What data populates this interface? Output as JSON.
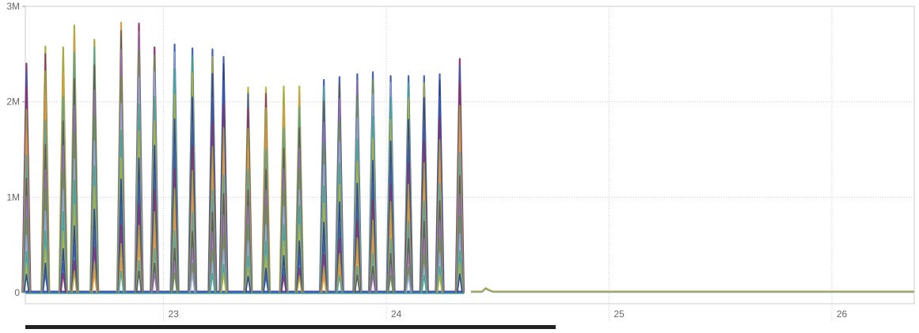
{
  "chart_data": {
    "type": "line",
    "title": "",
    "xlabel": "",
    "ylabel": "",
    "x_ticks": [
      "23",
      "24",
      "25",
      "26"
    ],
    "x_tick_values": [
      23,
      24,
      25,
      26
    ],
    "y_ticks": [
      "0",
      "1M",
      "2M",
      "3M"
    ],
    "y_tick_values": [
      0,
      1000000,
      2000000,
      3000000
    ],
    "xlim": [
      22.38,
      26.37
    ],
    "ylim": [
      0,
      3000000
    ],
    "grid": true,
    "legend": "none",
    "overlay_colors": [
      "#2b3f8f",
      "#3d5bb0",
      "#8b2f6f",
      "#a6a83a",
      "#d39b45",
      "#4fa5a0",
      "#5a5a5a",
      "#9a6fb0",
      "#6b8f4f",
      "#8fa8d6",
      "#3fa58a",
      "#b0b13a"
    ],
    "bursts": [
      {
        "x": 22.385,
        "peak": 2400000,
        "color": "#8b2f6f"
      },
      {
        "x": 22.47,
        "peak": 2580000,
        "color": "#a6a83a"
      },
      {
        "x": 22.55,
        "peak": 2570000,
        "color": "#a6a83a"
      },
      {
        "x": 22.6,
        "peak": 2800000,
        "color": "#a6a83a"
      },
      {
        "x": 22.69,
        "peak": 2650000,
        "color": "#a6a83a"
      },
      {
        "x": 22.81,
        "peak": 2830000,
        "color": "#d39b45"
      },
      {
        "x": 22.89,
        "peak": 2820000,
        "color": "#8b2f6f"
      },
      {
        "x": 22.96,
        "peak": 2570000,
        "color": "#8b2f6f"
      },
      {
        "x": 23.05,
        "peak": 2600000,
        "color": "#3d5bb0"
      },
      {
        "x": 23.13,
        "peak": 2560000,
        "color": "#3d5bb0"
      },
      {
        "x": 23.22,
        "peak": 2550000,
        "color": "#3d5bb0"
      },
      {
        "x": 23.27,
        "peak": 2470000,
        "color": "#3d5bb0"
      },
      {
        "x": 23.38,
        "peak": 2150000,
        "color": "#b0b13a"
      },
      {
        "x": 23.46,
        "peak": 2150000,
        "color": "#b0b13a"
      },
      {
        "x": 23.54,
        "peak": 2160000,
        "color": "#b0b13a"
      },
      {
        "x": 23.61,
        "peak": 2160000,
        "color": "#b0b13a"
      },
      {
        "x": 23.72,
        "peak": 2230000,
        "color": "#3d5bb0"
      },
      {
        "x": 23.79,
        "peak": 2260000,
        "color": "#3d5bb0"
      },
      {
        "x": 23.87,
        "peak": 2290000,
        "color": "#3d5bb0"
      },
      {
        "x": 23.94,
        "peak": 2310000,
        "color": "#3d5bb0"
      },
      {
        "x": 24.02,
        "peak": 2270000,
        "color": "#3d5bb0"
      },
      {
        "x": 24.1,
        "peak": 2270000,
        "color": "#3d5bb0"
      },
      {
        "x": 24.17,
        "peak": 2270000,
        "color": "#3d5bb0"
      },
      {
        "x": 24.24,
        "peak": 2290000,
        "color": "#3d5bb0"
      },
      {
        "x": 24.33,
        "peak": 2450000,
        "color": "#8b2f6f"
      }
    ],
    "baseline_after": {
      "x_start": 24.38,
      "x_end": 26.37,
      "value": 10000,
      "color": "#a6a83a"
    }
  }
}
